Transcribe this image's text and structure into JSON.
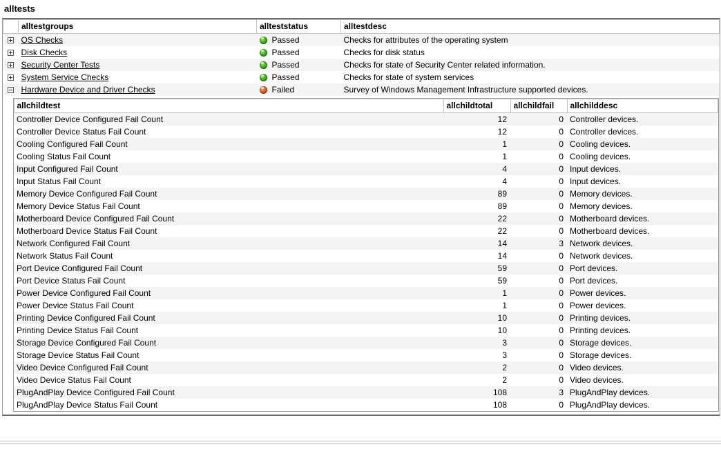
{
  "page": {
    "title": "alltests"
  },
  "main_grid": {
    "columns": [
      {
        "key": "alltestgroups",
        "label": "alltestgroups"
      },
      {
        "key": "alltestsstatus",
        "label": "allteststatus"
      },
      {
        "key": "alltestdesc",
        "label": "alltestdesc"
      }
    ],
    "rows": [
      {
        "expander": "plus",
        "group": "OS Checks",
        "status": "Passed",
        "status_icon": "green-orb-icon",
        "desc": "Checks for attributes of the operating system"
      },
      {
        "expander": "plus",
        "group": "Disk Checks",
        "status": "Passed",
        "status_icon": "green-orb-icon",
        "desc": "Checks for disk status"
      },
      {
        "expander": "plus",
        "group": "Security Center Tests",
        "status": "Passed",
        "status_icon": "green-orb-icon",
        "desc": "Checks for state of Security Center related information."
      },
      {
        "expander": "plus",
        "group": "System Service Checks",
        "status": "Passed",
        "status_icon": "green-orb-icon",
        "desc": "Checks for state of system services"
      },
      {
        "expander": "minus",
        "group": "Hardware Device and Driver Checks",
        "status": "Failed",
        "status_icon": "red-orb-icon",
        "desc": "Survey of Windows Management Infrastructure supported devices."
      }
    ]
  },
  "child_grid": {
    "columns": [
      {
        "key": "allchildtest",
        "label": "allchildtest"
      },
      {
        "key": "allchildtotal",
        "label": "allchildtotal"
      },
      {
        "key": "allchildfail",
        "label": "allchildfail"
      },
      {
        "key": "allchilddesc",
        "label": "allchilddesc"
      }
    ],
    "rows": [
      {
        "test": "Controller Device Configured Fail Count",
        "total": "12",
        "fail": "0",
        "desc": "Controller devices."
      },
      {
        "test": "Controller Device Status Fail Count",
        "total": "12",
        "fail": "0",
        "desc": "Controller devices."
      },
      {
        "test": "Cooling Configured Fail Count",
        "total": "1",
        "fail": "0",
        "desc": "Cooling devices."
      },
      {
        "test": "Cooling Status Fail Count",
        "total": "1",
        "fail": "0",
        "desc": "Cooling devices."
      },
      {
        "test": "Input Configured Fail Count",
        "total": "4",
        "fail": "0",
        "desc": "Input devices."
      },
      {
        "test": "Input Status Fail Count",
        "total": "4",
        "fail": "0",
        "desc": "Input devices."
      },
      {
        "test": "Memory Device Configured Fail Count",
        "total": "89",
        "fail": "0",
        "desc": "Memory devices."
      },
      {
        "test": "Memory Device Status Fail Count",
        "total": "89",
        "fail": "0",
        "desc": "Memory devices."
      },
      {
        "test": "Motherboard Device Configured Fail Count",
        "total": "22",
        "fail": "0",
        "desc": "Motherboard devices."
      },
      {
        "test": "Motherboard Device Status Fail Count",
        "total": "22",
        "fail": "0",
        "desc": "Motherboard devices."
      },
      {
        "test": "Network Configured Fail Count",
        "total": "14",
        "fail": "3",
        "desc": "Network devices."
      },
      {
        "test": "Network Status Fail Count",
        "total": "14",
        "fail": "0",
        "desc": "Network devices."
      },
      {
        "test": "Port Device Configured Fail Count",
        "total": "59",
        "fail": "0",
        "desc": "Port devices."
      },
      {
        "test": "Port Device Status Fail Count",
        "total": "59",
        "fail": "0",
        "desc": "Port devices."
      },
      {
        "test": "Power Device Configured Fail Count",
        "total": "1",
        "fail": "0",
        "desc": "Power devices."
      },
      {
        "test": "Power Device Status Fail Count",
        "total": "1",
        "fail": "0",
        "desc": "Power devices."
      },
      {
        "test": "Printing Device Configured Fail Count",
        "total": "10",
        "fail": "0",
        "desc": "Printing devices."
      },
      {
        "test": "Printing Device Status Fail Count",
        "total": "10",
        "fail": "0",
        "desc": "Printing devices."
      },
      {
        "test": "Storage Device Configured Fail Count",
        "total": "3",
        "fail": "0",
        "desc": "Storage devices."
      },
      {
        "test": "Storage Device Status Fail Count",
        "total": "3",
        "fail": "0",
        "desc": "Storage devices."
      },
      {
        "test": "Video Device Configured Fail Count",
        "total": "2",
        "fail": "0",
        "desc": "Video devices."
      },
      {
        "test": "Video Device Status Fail Count",
        "total": "2",
        "fail": "0",
        "desc": "Video devices."
      },
      {
        "test": "PlugAndPlay Device Configured Fail Count",
        "total": "108",
        "fail": "3",
        "desc": "PlugAndPlay devices."
      },
      {
        "test": "PlugAndPlay Device Status Fail Count",
        "total": "108",
        "fail": "0",
        "desc": "PlugAndPlay devices."
      }
    ]
  },
  "colors": {
    "pass": "#3fae1c",
    "fail": "#d2551f",
    "row_alt": "#f4f4f4",
    "border": "#9a9a9a",
    "header_border": "#c3c3c3"
  }
}
